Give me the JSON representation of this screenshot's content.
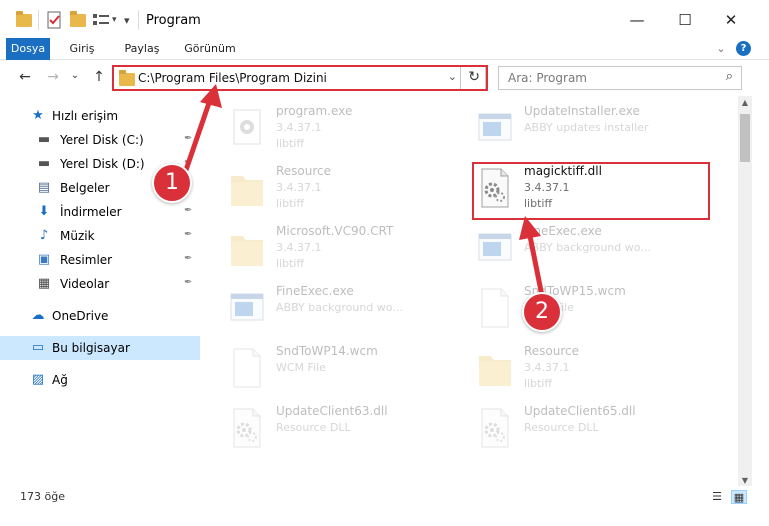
{
  "window": {
    "title": "Program",
    "minimize_glyph": "—",
    "maximize_glyph": "☐",
    "close_glyph": "✕"
  },
  "ribbon": {
    "tabs": [
      {
        "label": "Dosya",
        "is_file_tab": true
      },
      {
        "label": "Giriş",
        "is_file_tab": false
      },
      {
        "label": "Paylaş",
        "is_file_tab": false
      },
      {
        "label": "Görünüm",
        "is_file_tab": false
      }
    ],
    "expand_glyph": "⌄",
    "help_glyph": "?"
  },
  "navigation": {
    "back_glyph": "←",
    "forward_glyph": "→",
    "history_glyph": "⌄",
    "up_glyph": "↑",
    "address": "C:\\Program Files\\Program Dizini",
    "address_chevron": "⌄",
    "refresh_glyph": "↻",
    "search_placeholder": "Ara: Program",
    "search_glyph": "⌕"
  },
  "sidebar": {
    "items": [
      {
        "label": "Hızlı erişim",
        "icon": "star-icon",
        "glyph": "★",
        "color": "#1a6fc2",
        "pinned": false,
        "selected": false,
        "indent": false
      },
      {
        "label": "Yerel Disk (C:)",
        "icon": "drive-icon",
        "glyph": "▬",
        "color": "#555555",
        "pinned": true,
        "selected": false,
        "indent": true
      },
      {
        "label": "Yerel Disk (D:)",
        "icon": "drive-icon",
        "glyph": "▬",
        "color": "#555555",
        "pinned": true,
        "selected": false,
        "indent": true
      },
      {
        "label": "Belgeler",
        "icon": "document-icon",
        "glyph": "▤",
        "color": "#4a6a8a",
        "pinned": true,
        "selected": false,
        "indent": true
      },
      {
        "label": "İndirmeler",
        "icon": "download-icon",
        "glyph": "⬇",
        "color": "#1a6fc2",
        "pinned": true,
        "selected": false,
        "indent": true
      },
      {
        "label": "Müzik",
        "icon": "music-icon",
        "glyph": "♪",
        "color": "#1a6fc2",
        "pinned": true,
        "selected": false,
        "indent": true
      },
      {
        "label": "Resimler",
        "icon": "pictures-icon",
        "glyph": "▣",
        "color": "#3b7bbf",
        "pinned": true,
        "selected": false,
        "indent": true
      },
      {
        "label": "Videolar",
        "icon": "video-icon",
        "glyph": "▦",
        "color": "#444444",
        "pinned": true,
        "selected": false,
        "indent": true
      },
      {
        "label": "OneDrive",
        "icon": "cloud-icon",
        "glyph": "☁",
        "color": "#1a6fc2",
        "pinned": false,
        "selected": false,
        "indent": false
      },
      {
        "label": "Bu bilgisayar",
        "icon": "computer-icon",
        "glyph": "▭",
        "color": "#1a6fc2",
        "pinned": false,
        "selected": true,
        "indent": false
      },
      {
        "label": "Ağ",
        "icon": "network-icon",
        "glyph": "▨",
        "color": "#1a6fc2",
        "pinned": false,
        "selected": false,
        "indent": false
      }
    ],
    "pin_glyph": "✒"
  },
  "files": [
    {
      "name": "program.exe",
      "line2": "3.4.37.1",
      "line3": "libtiff",
      "kind": "exe",
      "faded": true
    },
    {
      "name": "UpdateInstaller.exe",
      "line2": "ABBY updates installer",
      "line3": "",
      "kind": "app",
      "faded": true
    },
    {
      "name": "Resource",
      "line2": "3.4.37.1",
      "line3": "libtiff",
      "kind": "folder",
      "faded": true
    },
    {
      "name": "magicktiff.dll",
      "line2": "3.4.37.1",
      "line3": "libtiff",
      "kind": "dll",
      "faded": false
    },
    {
      "name": "Microsoft.VC90.CRT",
      "line2": "3.4.37.1",
      "line3": "libtiff",
      "kind": "folder",
      "faded": true
    },
    {
      "name": "FineExec.exe",
      "line2": "ABBY background wo...",
      "line3": "",
      "kind": "app",
      "faded": true
    },
    {
      "name": "FineExec.exe",
      "line2": "ABBY background wo...",
      "line3": "",
      "kind": "app",
      "faded": true
    },
    {
      "name": "SndToWP15.wcm",
      "line2": "WCM File",
      "line3": "",
      "kind": "blank",
      "faded": true
    },
    {
      "name": "SndToWP14.wcm",
      "line2": "WCM File",
      "line3": "",
      "kind": "blank",
      "faded": true
    },
    {
      "name": "Resource",
      "line2": "3.4.37.1",
      "line3": "libtiff",
      "kind": "folder",
      "faded": true
    },
    {
      "name": "UpdateClient63.dll",
      "line2": "Resource DLL",
      "line3": "",
      "kind": "dll",
      "faded": true
    },
    {
      "name": "UpdateClient65.dll",
      "line2": "Resource DLL",
      "line3": "",
      "kind": "dll",
      "faded": true
    }
  ],
  "status": {
    "item_count": "173 öğe",
    "details_view_glyph": "☰",
    "tiles_view_glyph": "▦"
  },
  "scrollbar": {
    "up_glyph": "▲",
    "down_glyph": "▼"
  },
  "annotations": {
    "step1": "1",
    "step2": "2",
    "color": "#d9303a"
  }
}
